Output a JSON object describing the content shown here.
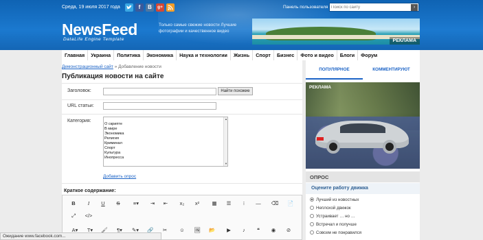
{
  "topbar": {
    "date": "Среда, 19 июля 2017 года",
    "social": [
      "twitter",
      "facebook",
      "vk",
      "google-plus",
      "rss"
    ],
    "social_labels": {
      "fb": "f",
      "vk": "В",
      "gp": "g+"
    },
    "user_panel": "Панель пользователя",
    "search_placeholder": "Поиск по сайту"
  },
  "header": {
    "logo": "NewsFeed",
    "tagline": "DataLife Engine Template",
    "slogan": "Только самые свежие новости Лучшие фотографии и качественное видео",
    "banner_label": "РЕКЛАМА"
  },
  "nav": [
    "Главная",
    "Украина",
    "Политика",
    "Экономика",
    "Наука и технологии",
    "Жизнь",
    "Спорт",
    "Бизнес",
    "Фото и видео",
    "Блоги",
    "Форум"
  ],
  "breadcrumb": {
    "link": "Демонстрационный сайт",
    "separator": "»",
    "current": "Добавление новости"
  },
  "page_title": "Публикация новости на сайте",
  "form": {
    "title_label": "Заголовок:",
    "similar_button": "Найти похожие",
    "url_label": "URL статьи:",
    "category_label": "Категория:",
    "categories": [
      "О скрипте",
      "В мире",
      "Экономика",
      "Религия",
      "Криминал",
      "Спорт",
      "Культура",
      "Инопресса"
    ],
    "add_poll": "Добавить опрос",
    "short_content_label": "Краткое содержание:"
  },
  "sidebar": {
    "tab_popular": "ПОПУЛЯРНОЕ",
    "tab_commented": "КОММЕНТИРУЮТ",
    "ad_label": "РЕКЛАМА",
    "poll_header": "ОПРОС",
    "poll_question": "Оцените работу движка",
    "poll_options": [
      "Лучший из новостных",
      "Неплохой движок",
      "Устраивает … но …",
      "Встречал и получше",
      "Совсем не понравился"
    ]
  },
  "statusbar": "Ожидание www.facebook.com..."
}
